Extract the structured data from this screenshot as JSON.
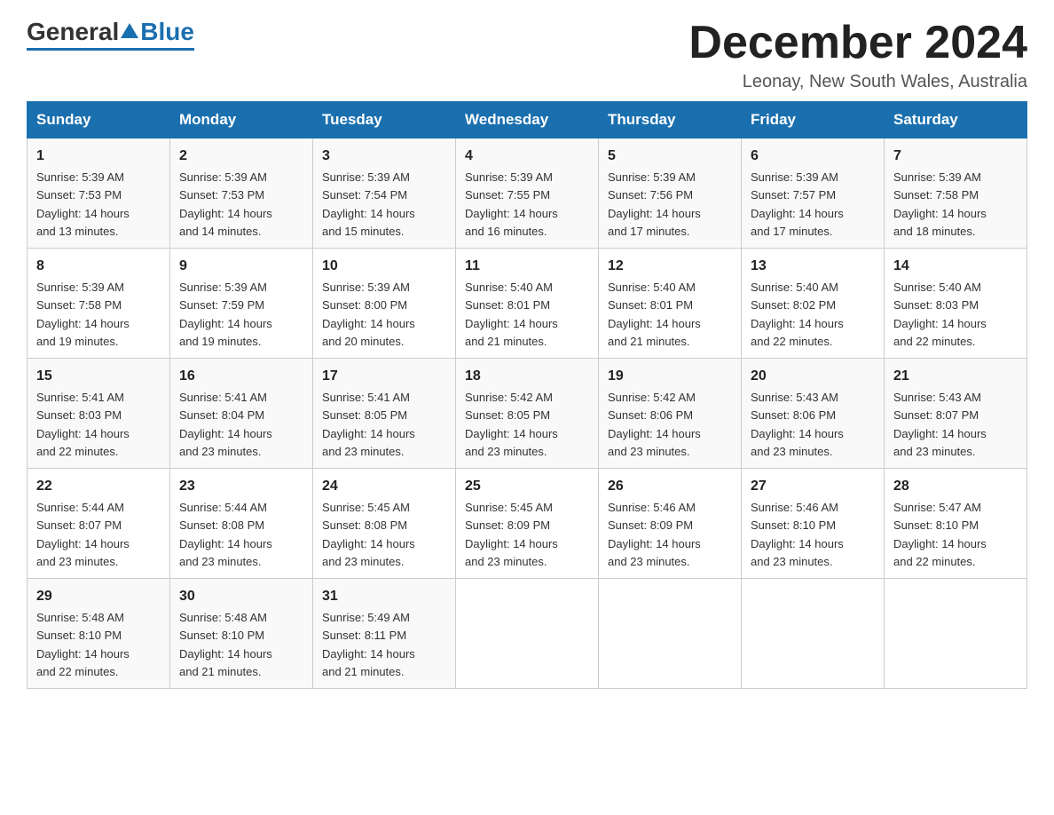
{
  "header": {
    "logo_general": "General",
    "logo_blue": "Blue",
    "month_title": "December 2024",
    "location": "Leonay, New South Wales, Australia"
  },
  "days_of_week": [
    "Sunday",
    "Monday",
    "Tuesday",
    "Wednesday",
    "Thursday",
    "Friday",
    "Saturday"
  ],
  "weeks": [
    [
      {
        "day": "1",
        "sunrise": "5:39 AM",
        "sunset": "7:53 PM",
        "daylight": "14 hours and 13 minutes."
      },
      {
        "day": "2",
        "sunrise": "5:39 AM",
        "sunset": "7:53 PM",
        "daylight": "14 hours and 14 minutes."
      },
      {
        "day": "3",
        "sunrise": "5:39 AM",
        "sunset": "7:54 PM",
        "daylight": "14 hours and 15 minutes."
      },
      {
        "day": "4",
        "sunrise": "5:39 AM",
        "sunset": "7:55 PM",
        "daylight": "14 hours and 16 minutes."
      },
      {
        "day": "5",
        "sunrise": "5:39 AM",
        "sunset": "7:56 PM",
        "daylight": "14 hours and 17 minutes."
      },
      {
        "day": "6",
        "sunrise": "5:39 AM",
        "sunset": "7:57 PM",
        "daylight": "14 hours and 17 minutes."
      },
      {
        "day": "7",
        "sunrise": "5:39 AM",
        "sunset": "7:58 PM",
        "daylight": "14 hours and 18 minutes."
      }
    ],
    [
      {
        "day": "8",
        "sunrise": "5:39 AM",
        "sunset": "7:58 PM",
        "daylight": "14 hours and 19 minutes."
      },
      {
        "day": "9",
        "sunrise": "5:39 AM",
        "sunset": "7:59 PM",
        "daylight": "14 hours and 19 minutes."
      },
      {
        "day": "10",
        "sunrise": "5:39 AM",
        "sunset": "8:00 PM",
        "daylight": "14 hours and 20 minutes."
      },
      {
        "day": "11",
        "sunrise": "5:40 AM",
        "sunset": "8:01 PM",
        "daylight": "14 hours and 21 minutes."
      },
      {
        "day": "12",
        "sunrise": "5:40 AM",
        "sunset": "8:01 PM",
        "daylight": "14 hours and 21 minutes."
      },
      {
        "day": "13",
        "sunrise": "5:40 AM",
        "sunset": "8:02 PM",
        "daylight": "14 hours and 22 minutes."
      },
      {
        "day": "14",
        "sunrise": "5:40 AM",
        "sunset": "8:03 PM",
        "daylight": "14 hours and 22 minutes."
      }
    ],
    [
      {
        "day": "15",
        "sunrise": "5:41 AM",
        "sunset": "8:03 PM",
        "daylight": "14 hours and 22 minutes."
      },
      {
        "day": "16",
        "sunrise": "5:41 AM",
        "sunset": "8:04 PM",
        "daylight": "14 hours and 23 minutes."
      },
      {
        "day": "17",
        "sunrise": "5:41 AM",
        "sunset": "8:05 PM",
        "daylight": "14 hours and 23 minutes."
      },
      {
        "day": "18",
        "sunrise": "5:42 AM",
        "sunset": "8:05 PM",
        "daylight": "14 hours and 23 minutes."
      },
      {
        "day": "19",
        "sunrise": "5:42 AM",
        "sunset": "8:06 PM",
        "daylight": "14 hours and 23 minutes."
      },
      {
        "day": "20",
        "sunrise": "5:43 AM",
        "sunset": "8:06 PM",
        "daylight": "14 hours and 23 minutes."
      },
      {
        "day": "21",
        "sunrise": "5:43 AM",
        "sunset": "8:07 PM",
        "daylight": "14 hours and 23 minutes."
      }
    ],
    [
      {
        "day": "22",
        "sunrise": "5:44 AM",
        "sunset": "8:07 PM",
        "daylight": "14 hours and 23 minutes."
      },
      {
        "day": "23",
        "sunrise": "5:44 AM",
        "sunset": "8:08 PM",
        "daylight": "14 hours and 23 minutes."
      },
      {
        "day": "24",
        "sunrise": "5:45 AM",
        "sunset": "8:08 PM",
        "daylight": "14 hours and 23 minutes."
      },
      {
        "day": "25",
        "sunrise": "5:45 AM",
        "sunset": "8:09 PM",
        "daylight": "14 hours and 23 minutes."
      },
      {
        "day": "26",
        "sunrise": "5:46 AM",
        "sunset": "8:09 PM",
        "daylight": "14 hours and 23 minutes."
      },
      {
        "day": "27",
        "sunrise": "5:46 AM",
        "sunset": "8:10 PM",
        "daylight": "14 hours and 23 minutes."
      },
      {
        "day": "28",
        "sunrise": "5:47 AM",
        "sunset": "8:10 PM",
        "daylight": "14 hours and 22 minutes."
      }
    ],
    [
      {
        "day": "29",
        "sunrise": "5:48 AM",
        "sunset": "8:10 PM",
        "daylight": "14 hours and 22 minutes."
      },
      {
        "day": "30",
        "sunrise": "5:48 AM",
        "sunset": "8:10 PM",
        "daylight": "14 hours and 21 minutes."
      },
      {
        "day": "31",
        "sunrise": "5:49 AM",
        "sunset": "8:11 PM",
        "daylight": "14 hours and 21 minutes."
      },
      null,
      null,
      null,
      null
    ]
  ],
  "labels": {
    "sunrise": "Sunrise:",
    "sunset": "Sunset:",
    "daylight": "Daylight:"
  }
}
